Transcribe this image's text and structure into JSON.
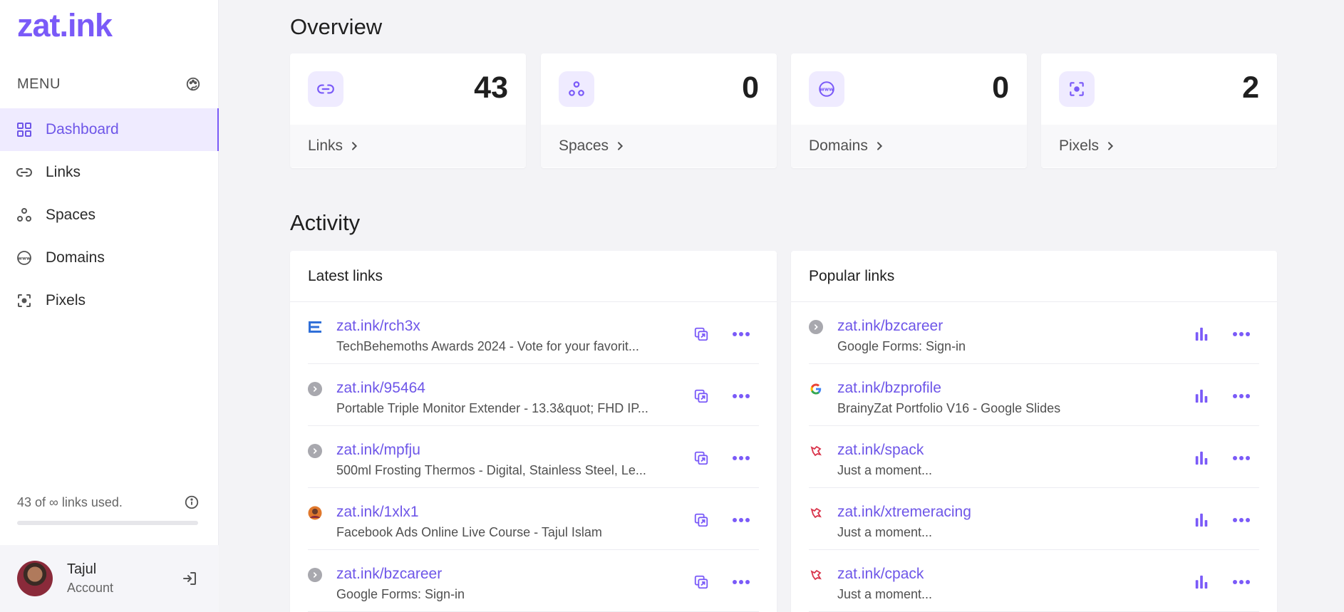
{
  "app": {
    "logo": "zat.ink"
  },
  "sidebar": {
    "menu_label": "MENU",
    "items": [
      {
        "label": "Dashboard",
        "icon": "grid-icon",
        "active": true
      },
      {
        "label": "Links",
        "icon": "link-icon"
      },
      {
        "label": "Spaces",
        "icon": "spaces-icon"
      },
      {
        "label": "Domains",
        "icon": "www-icon"
      },
      {
        "label": "Pixels",
        "icon": "pixel-icon"
      }
    ],
    "usage_text": "43 of ∞ links used.",
    "usage_fraction": 0.0,
    "account_name": "Tajul",
    "account_sub": "Account"
  },
  "overview": {
    "title": "Overview",
    "stats": [
      {
        "label": "Links",
        "value": "43",
        "icon": "link-icon"
      },
      {
        "label": "Spaces",
        "value": "0",
        "icon": "spaces-icon"
      },
      {
        "label": "Domains",
        "value": "0",
        "icon": "www-icon"
      },
      {
        "label": "Pixels",
        "value": "2",
        "icon": "pixel-icon"
      }
    ]
  },
  "activity": {
    "title": "Activity",
    "latest": {
      "title": "Latest links",
      "rows": [
        {
          "url": "zat.ink/rch3x",
          "title": "TechBehemoths Awards 2024 - Vote for your favorit...",
          "favicon": "techbehemoths-icon"
        },
        {
          "url": "zat.ink/95464",
          "title": "Portable Triple Monitor Extender - 13.3&quot; FHD IP...",
          "favicon": "default-favicon-icon"
        },
        {
          "url": "zat.ink/mpfju",
          "title": "500ml Frosting Thermos - Digital, Stainless Steel, Le...",
          "favicon": "default-favicon-icon"
        },
        {
          "url": "zat.ink/1xlx1",
          "title": "Facebook Ads Online Live Course - Tajul Islam",
          "favicon": "avatar-favicon-icon"
        },
        {
          "url": "zat.ink/bzcareer",
          "title": "Google Forms: Sign-in",
          "favicon": "default-favicon-icon"
        }
      ]
    },
    "popular": {
      "title": "Popular links",
      "rows": [
        {
          "url": "zat.ink/bzcareer",
          "title": "Google Forms: Sign-in",
          "favicon": "default-favicon-icon"
        },
        {
          "url": "zat.ink/bzprofile",
          "title": "BrainyZat Portfolio V16 - Google Slides",
          "favicon": "google-icon"
        },
        {
          "url": "zat.ink/spack",
          "title": "Just a moment...",
          "favicon": "red-favicon-icon"
        },
        {
          "url": "zat.ink/xtremeracing",
          "title": "Just a moment...",
          "favicon": "red-favicon-icon"
        },
        {
          "url": "zat.ink/cpack",
          "title": "Just a moment...",
          "favicon": "red-favicon-icon"
        }
      ]
    }
  },
  "colors": {
    "accent": "#7a5af8",
    "accent_light": "#efebff",
    "bg": "#f3f3f6"
  }
}
